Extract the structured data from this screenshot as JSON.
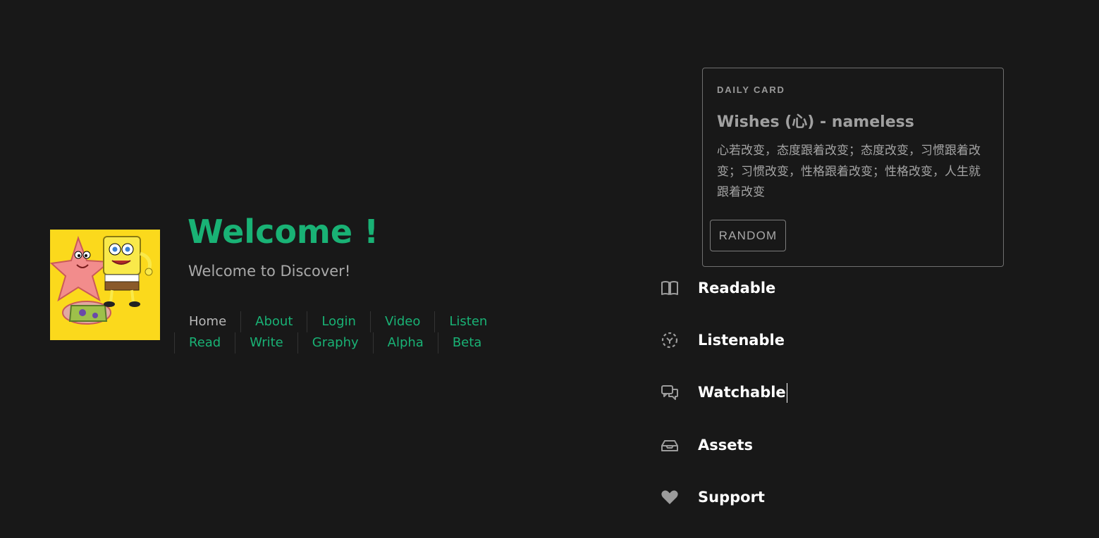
{
  "hero": {
    "title": "Welcome !",
    "subtitle": "Welcome to Discover!"
  },
  "nav": {
    "row1": [
      {
        "label": "Home",
        "active": true
      },
      {
        "label": "About"
      },
      {
        "label": "Login"
      },
      {
        "label": "Video"
      },
      {
        "label": "Listen"
      }
    ],
    "row2": [
      {
        "label": "Read"
      },
      {
        "label": "Write"
      },
      {
        "label": "Graphy"
      },
      {
        "label": "Alpha"
      },
      {
        "label": "Beta"
      }
    ]
  },
  "daily_card": {
    "label": "DAILY CARD",
    "title": "Wishes (心) - nameless",
    "body": "心若改变，态度跟着改变；态度改变，习惯跟着改变；习惯改变，性格跟着改变；性格改变，人生就跟着改变",
    "button": "RANDOM"
  },
  "features": [
    {
      "label": "Readable",
      "icon": "book-open-icon"
    },
    {
      "label": "Listenable",
      "icon": "focus-dashed-icon"
    },
    {
      "label": "Watchable",
      "icon": "chat-bubbles-icon"
    },
    {
      "label": "Assets",
      "icon": "inbox-tray-icon"
    },
    {
      "label": "Support",
      "icon": "heart-icon"
    }
  ],
  "colors": {
    "background": "#181818",
    "accent": "#19b275",
    "muted_text": "#a9a9a9",
    "avatar_background": "#fbd91c"
  }
}
